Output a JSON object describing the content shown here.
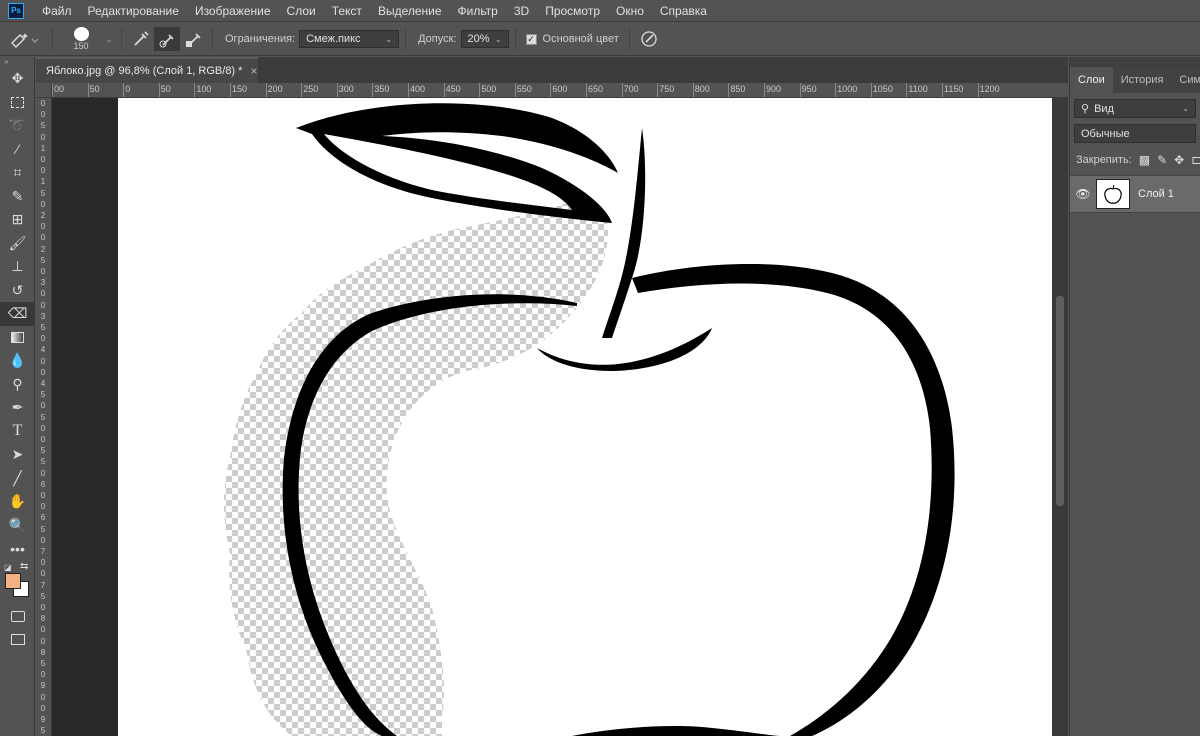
{
  "app": {
    "logo_text": "Ps"
  },
  "menu": [
    "Файл",
    "Редактирование",
    "Изображение",
    "Слои",
    "Текст",
    "Выделение",
    "Фильтр",
    "3D",
    "Просмотр",
    "Окно",
    "Справка"
  ],
  "options": {
    "brush_size": "150",
    "limits_label": "Ограничения:",
    "limits_value": "Смеж.пикс",
    "tolerance_label": "Допуск:",
    "tolerance_value": "20%",
    "main_color_label": "Основной цвет"
  },
  "document": {
    "tab_title": "Яблоко.jpg @ 96,8% (Слой 1, RGB/8) *",
    "close": "×",
    "ruler_h": [
      "00",
      "50",
      "0",
      "50",
      "100",
      "150",
      "200",
      "250",
      "300",
      "350",
      "400",
      "450",
      "500",
      "550",
      "600",
      "650",
      "700",
      "750",
      "800",
      "850",
      "900",
      "950",
      "1000",
      "1050",
      "1100",
      "1150",
      "1200"
    ],
    "ruler_v": [
      "0",
      "0",
      "5",
      "0",
      "1",
      "0",
      "0",
      "1",
      "5",
      "0",
      "2",
      "0",
      "0",
      "2",
      "5",
      "0",
      "3",
      "0",
      "0",
      "3",
      "5",
      "0",
      "4",
      "0",
      "0",
      "4",
      "5",
      "0",
      "5",
      "0",
      "0",
      "5",
      "5",
      "0",
      "6",
      "0",
      "0",
      "6",
      "5",
      "0",
      "7",
      "0",
      "0",
      "7",
      "5",
      "0",
      "8",
      "0",
      "0",
      "8",
      "5",
      "0",
      "9",
      "0",
      "0",
      "9",
      "5",
      "0"
    ]
  },
  "panel": {
    "tabs": [
      "Слои",
      "История",
      "Симв"
    ],
    "search_value": "Вид",
    "blend_mode": "Обычные",
    "lock_label": "Закрепить:",
    "layer_name": "Слой 1"
  },
  "colors": {
    "foreground": "#f4b183",
    "background": "#ffffff"
  }
}
